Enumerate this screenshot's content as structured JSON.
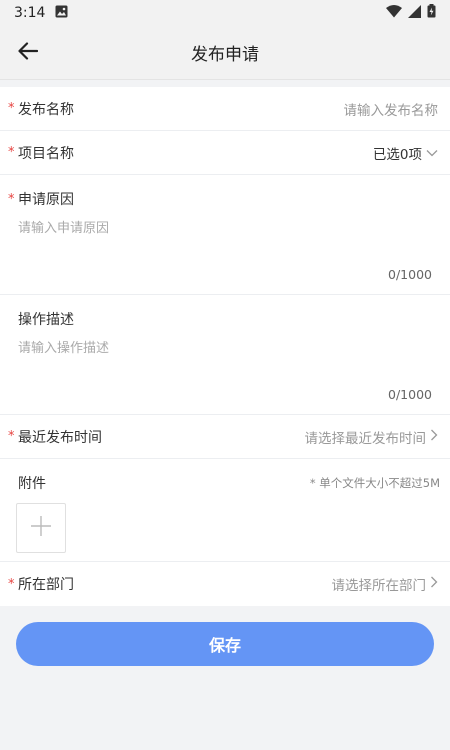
{
  "status_bar": {
    "time": "3:14"
  },
  "header": {
    "title": "发布申请"
  },
  "form": {
    "required_mark": "*",
    "release_name": {
      "label": "发布名称",
      "placeholder": "请输入发布名称"
    },
    "project_name": {
      "label": "项目名称",
      "value": "已选0项"
    },
    "reason": {
      "label": "申请原因",
      "placeholder": "请输入申请原因",
      "counter": "0/1000"
    },
    "operation": {
      "label": "操作描述",
      "placeholder": "请输入操作描述",
      "counter": "0/1000"
    },
    "recent_time": {
      "label": "最近发布时间",
      "placeholder": "请选择最近发布时间"
    },
    "attachment": {
      "label": "附件",
      "hint": "* 单个文件大小不超过5M"
    },
    "department": {
      "label": "所在部门",
      "placeholder": "请选择所在部门"
    }
  },
  "footer": {
    "save_label": "保存"
  },
  "colors": {
    "primary": "#6495f5",
    "required": "#e64340"
  }
}
